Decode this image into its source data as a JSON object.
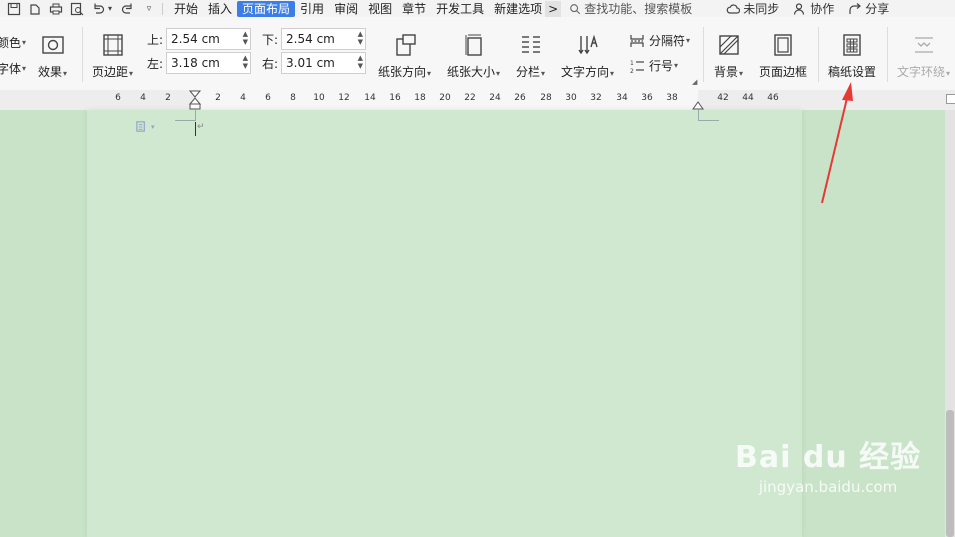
{
  "menubar": {
    "tabs": [
      {
        "label": "开始"
      },
      {
        "label": "插入"
      },
      {
        "label": "页面布局"
      },
      {
        "label": "引用"
      },
      {
        "label": "审阅"
      },
      {
        "label": "视图"
      },
      {
        "label": "章节"
      },
      {
        "label": "开发工具"
      },
      {
        "label": "新建选项"
      }
    ],
    "more_label": ">",
    "search_label": "查找功能、搜索模板",
    "sync_label": "未同步",
    "collab_label": "协作",
    "share_label": "分享"
  },
  "ribbon": {
    "color_label": "颜色",
    "font_label": "字体",
    "effect_label": "效果",
    "margins_label": "页边距",
    "top_label": "上:",
    "top_value": "2.54 cm",
    "bottom_label": "下:",
    "bottom_value": "2.54 cm",
    "left_label": "左:",
    "left_value": "3.18 cm",
    "right_label": "右:",
    "right_value": "3.01 cm",
    "orientation_label": "纸张方向",
    "size_label": "纸张大小",
    "columns_label": "分栏",
    "text_direction_label": "文字方向",
    "breaks_label": "分隔符",
    "line_numbers_label": "行号",
    "background_label": "背景",
    "page_border_label": "页面边框",
    "manuscript_label": "稿纸设置",
    "text_wrap_label": "文字环绕"
  },
  "ruler": {
    "ticks": [
      "6",
      "4",
      "2",
      "2",
      "4",
      "6",
      "8",
      "10",
      "12",
      "14",
      "16",
      "18",
      "20",
      "22",
      "24",
      "26",
      "28",
      "30",
      "32",
      "34",
      "36",
      "38",
      "42",
      "44",
      "46"
    ]
  },
  "watermark": {
    "brand": "Bai du 经验",
    "url": "jingyan.baidu.com"
  },
  "colors": {
    "accent": "#3c7ee8",
    "page_bg": "#cfe8cf",
    "arrow": "#e53935"
  }
}
